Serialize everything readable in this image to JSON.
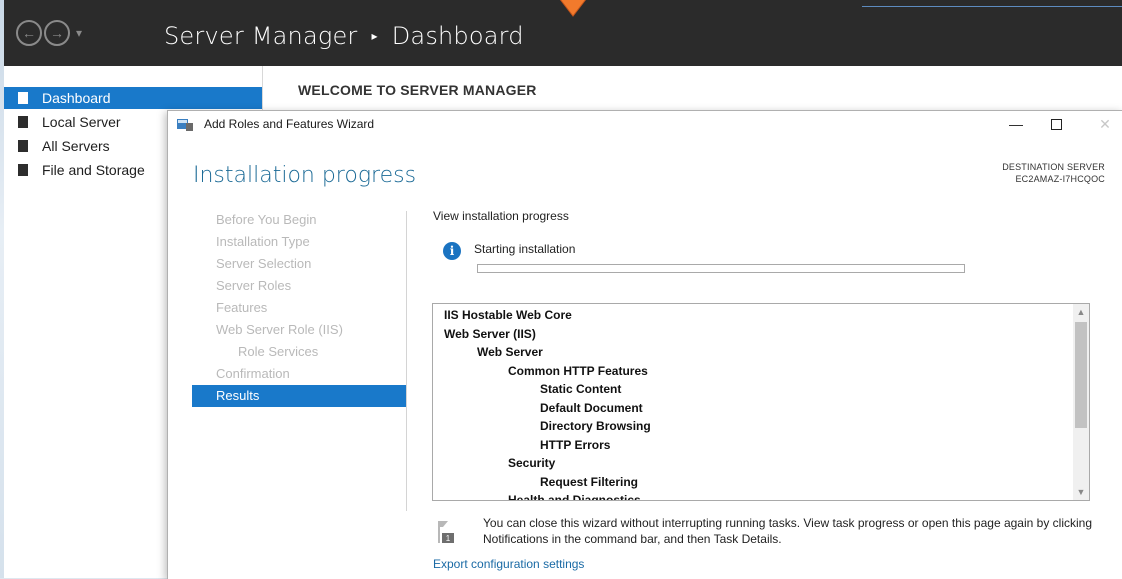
{
  "server_manager": {
    "breadcrumb_app": "Server Manager",
    "breadcrumb_separator": "▸",
    "breadcrumb_page": "Dashboard",
    "welcome": "WELCOME TO SERVER MANAGER",
    "sidebar": [
      {
        "label": "Dashboard",
        "active": true,
        "icon": "dashboard-icon"
      },
      {
        "label": "Local Server",
        "active": false,
        "icon": "server-icon"
      },
      {
        "label": "All Servers",
        "active": false,
        "icon": "servers-icon"
      },
      {
        "label": "File and Storage",
        "active": false,
        "icon": "storage-icon"
      }
    ]
  },
  "wizard": {
    "title": "Add Roles and Features Wizard",
    "heading": "Installation progress",
    "destination_label": "DESTINATION SERVER",
    "destination_name": "EC2AMAZ-I7HCQOC",
    "steps": [
      {
        "label": "Before You Begin",
        "state": "done"
      },
      {
        "label": "Installation Type",
        "state": "done"
      },
      {
        "label": "Server Selection",
        "state": "done"
      },
      {
        "label": "Server Roles",
        "state": "done"
      },
      {
        "label": "Features",
        "state": "done"
      },
      {
        "label": "Web Server Role (IIS)",
        "state": "done"
      },
      {
        "label": "Role Services",
        "state": "sub"
      },
      {
        "label": "Confirmation",
        "state": "done"
      },
      {
        "label": "Results",
        "state": "active"
      }
    ],
    "view_progress": "View installation progress",
    "status": "Starting installation",
    "progress": 0,
    "features": [
      {
        "label": "IIS Hostable Web Core",
        "level": 0
      },
      {
        "label": "Web Server (IIS)",
        "level": 0
      },
      {
        "label": "Web Server",
        "level": 1
      },
      {
        "label": "Common HTTP Features",
        "level": 2
      },
      {
        "label": "Static Content",
        "level": 3
      },
      {
        "label": "Default Document",
        "level": 3
      },
      {
        "label": "Directory Browsing",
        "level": 3
      },
      {
        "label": "HTTP Errors",
        "level": 3
      },
      {
        "label": "Security",
        "level": 2
      },
      {
        "label": "Request Filtering",
        "level": 3
      },
      {
        "label": "Health and Diagnostics",
        "level": 2
      }
    ],
    "note": "You can close this wizard without interrupting running tasks. View task progress or open this page again by clicking Notifications in the command bar, and then Task Details.",
    "export_link": "Export configuration settings",
    "colors": {
      "accent": "#1979ca",
      "heading": "#1b6a96",
      "titlebar": "#2b2b2b"
    }
  }
}
